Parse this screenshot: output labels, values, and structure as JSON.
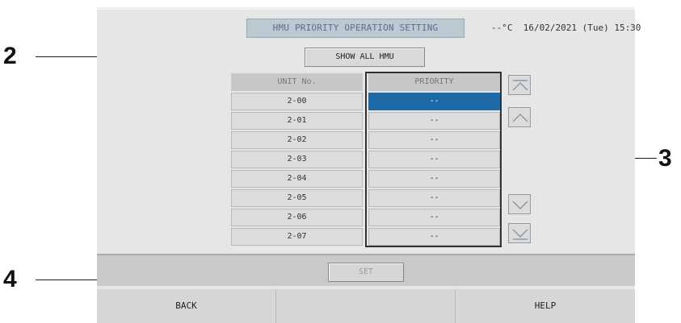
{
  "callouts": [
    "2",
    "3",
    "4"
  ],
  "header": {
    "title": "HMU PRIORITY OPERATION SETTING",
    "status": "--°C  16/02/2021 (Tue) 15:30"
  },
  "buttons": {
    "show_all": "SHOW ALL HMU",
    "set": "SET"
  },
  "table": {
    "col_unit": "UNIT No.",
    "col_priority": "PRIORITY",
    "rows": [
      {
        "unit": "2-00",
        "priority": "--",
        "selected": true
      },
      {
        "unit": "2-01",
        "priority": "--"
      },
      {
        "unit": "2-02",
        "priority": "--"
      },
      {
        "unit": "2-03",
        "priority": "--"
      },
      {
        "unit": "2-04",
        "priority": "--"
      },
      {
        "unit": "2-05",
        "priority": "--"
      },
      {
        "unit": "2-06",
        "priority": "--"
      },
      {
        "unit": "2-07",
        "priority": "--"
      }
    ]
  },
  "scroll": {
    "top_icon": "scroll-to-top-icon",
    "up_icon": "chevron-up-icon",
    "down_icon": "chevron-down-icon",
    "bottom_icon": "scroll-to-bottom-icon"
  },
  "footer": {
    "back": "BACK",
    "middle": "",
    "help": "HELP"
  },
  "colors": {
    "selected_row": "#1c6aa6",
    "title_bg": "#bcc8d2",
    "screen_bg": "#e6e6e6"
  }
}
